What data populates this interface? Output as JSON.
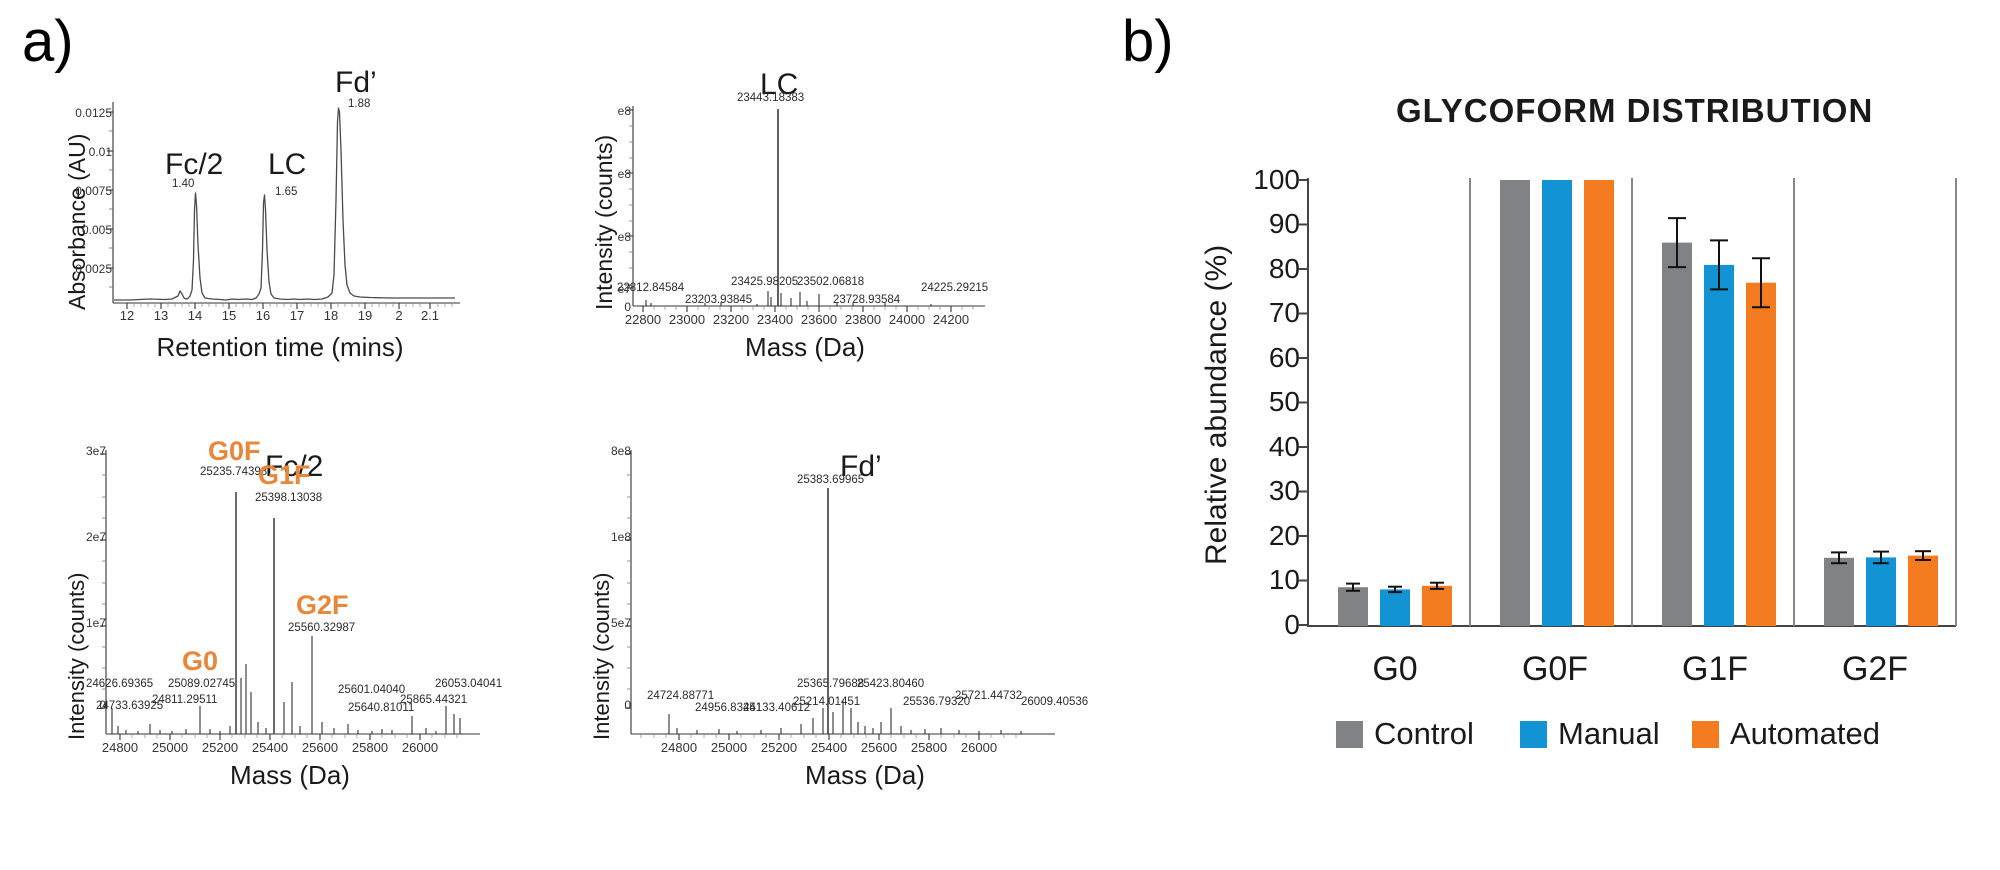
{
  "panels": {
    "a_letter": "a)",
    "b_letter": "b)"
  },
  "chromatogram": {
    "title_peaks": [
      {
        "label": "Fc/2",
        "rt": "1.40"
      },
      {
        "label": "LC",
        "rt": "1.65"
      },
      {
        "label": "Fd’",
        "rt": "1.88"
      }
    ],
    "ylabel": "Absorbance (AU)",
    "xlabel": "Retention time (mins)",
    "yticks": [
      "0.0125",
      "0.01",
      "0.0075",
      "0.005",
      "0.0025"
    ],
    "xticks": [
      "12",
      "13",
      "14",
      "15",
      "16",
      "17",
      "18",
      "19",
      "2",
      "2.1"
    ]
  },
  "lc_spectrum": {
    "title": "LC",
    "ylabel": "Intensity (counts)",
    "xlabel": "Mass (Da)",
    "yticks": [
      "e8",
      "e8",
      "e8",
      "e7",
      "0"
    ],
    "xticks": [
      "22800",
      "23000",
      "23200",
      "23400",
      "23600",
      "23800",
      "24000",
      "24200"
    ],
    "main_peak": "23443.18383",
    "peak_labels": [
      "22812.84584",
      "23203.93845",
      "23425.98205",
      "23502.06818",
      "23728.93584",
      "24225.29215"
    ]
  },
  "fc2_spectrum": {
    "title": "Fc/2",
    "ylabel": "Intensity (counts)",
    "xlabel": "Mass (Da)",
    "yticks": [
      "3e7",
      "2e7",
      "1e7",
      "0"
    ],
    "xticks": [
      "24800",
      "25000",
      "25200",
      "25400",
      "25600",
      "25800",
      "26000"
    ],
    "glycoforms": [
      {
        "name": "G0F",
        "mass": "25235.74398"
      },
      {
        "name": "G1F",
        "mass": "25398.13038"
      },
      {
        "name": "G0",
        "mass": "25089.02745"
      },
      {
        "name": "G2F",
        "mass": "25560.32987"
      }
    ],
    "peak_labels": [
      "24626.69365",
      "24733.63925",
      "24811.29511",
      "25601.04040",
      "25640.81011",
      "25865.44321",
      "26053.04041"
    ]
  },
  "fd_spectrum": {
    "title": "Fd’",
    "ylabel": "Intensity (counts)",
    "xlabel": "Mass (Da)",
    "yticks": [
      "8e8",
      "1e8",
      "5e7",
      "0"
    ],
    "xticks": [
      "24800",
      "25000",
      "25200",
      "25400",
      "25600",
      "25800",
      "26000"
    ],
    "main_peak": "25383.69965",
    "peak_labels": [
      "24724.88771",
      "24956.83441",
      "25133.40612",
      "25214.01451",
      "25365.79688",
      "25423.80460",
      "25536.79320",
      "25721.44732",
      "26009.40536"
    ]
  },
  "chart_data": {
    "type": "bar",
    "title": "GLYCOFORM  DISTRIBUTION",
    "xlabel": "",
    "ylabel": "Relative abundance (%)",
    "categories": [
      "G0",
      "G0F",
      "G1F",
      "G2F"
    ],
    "ylim": [
      0,
      100
    ],
    "yticks": [
      0,
      10,
      20,
      30,
      40,
      50,
      60,
      70,
      80,
      90,
      100
    ],
    "grid": false,
    "legend_position": "bottom",
    "series": [
      {
        "name": "Control",
        "color": "#808285",
        "values": [
          8.5,
          100,
          86,
          15.3
        ],
        "errors": [
          0.8,
          0,
          5.5,
          1.2
        ]
      },
      {
        "name": "Manual",
        "color": "#1193D4",
        "values": [
          8.0,
          100,
          81,
          15.4
        ],
        "errors": [
          0.6,
          0,
          5.5,
          1.3
        ]
      },
      {
        "name": "Automated",
        "color": "#F47B20",
        "values": [
          8.8,
          100,
          77,
          15.8
        ],
        "errors": [
          0.7,
          0,
          5.5,
          1.0
        ]
      }
    ]
  }
}
